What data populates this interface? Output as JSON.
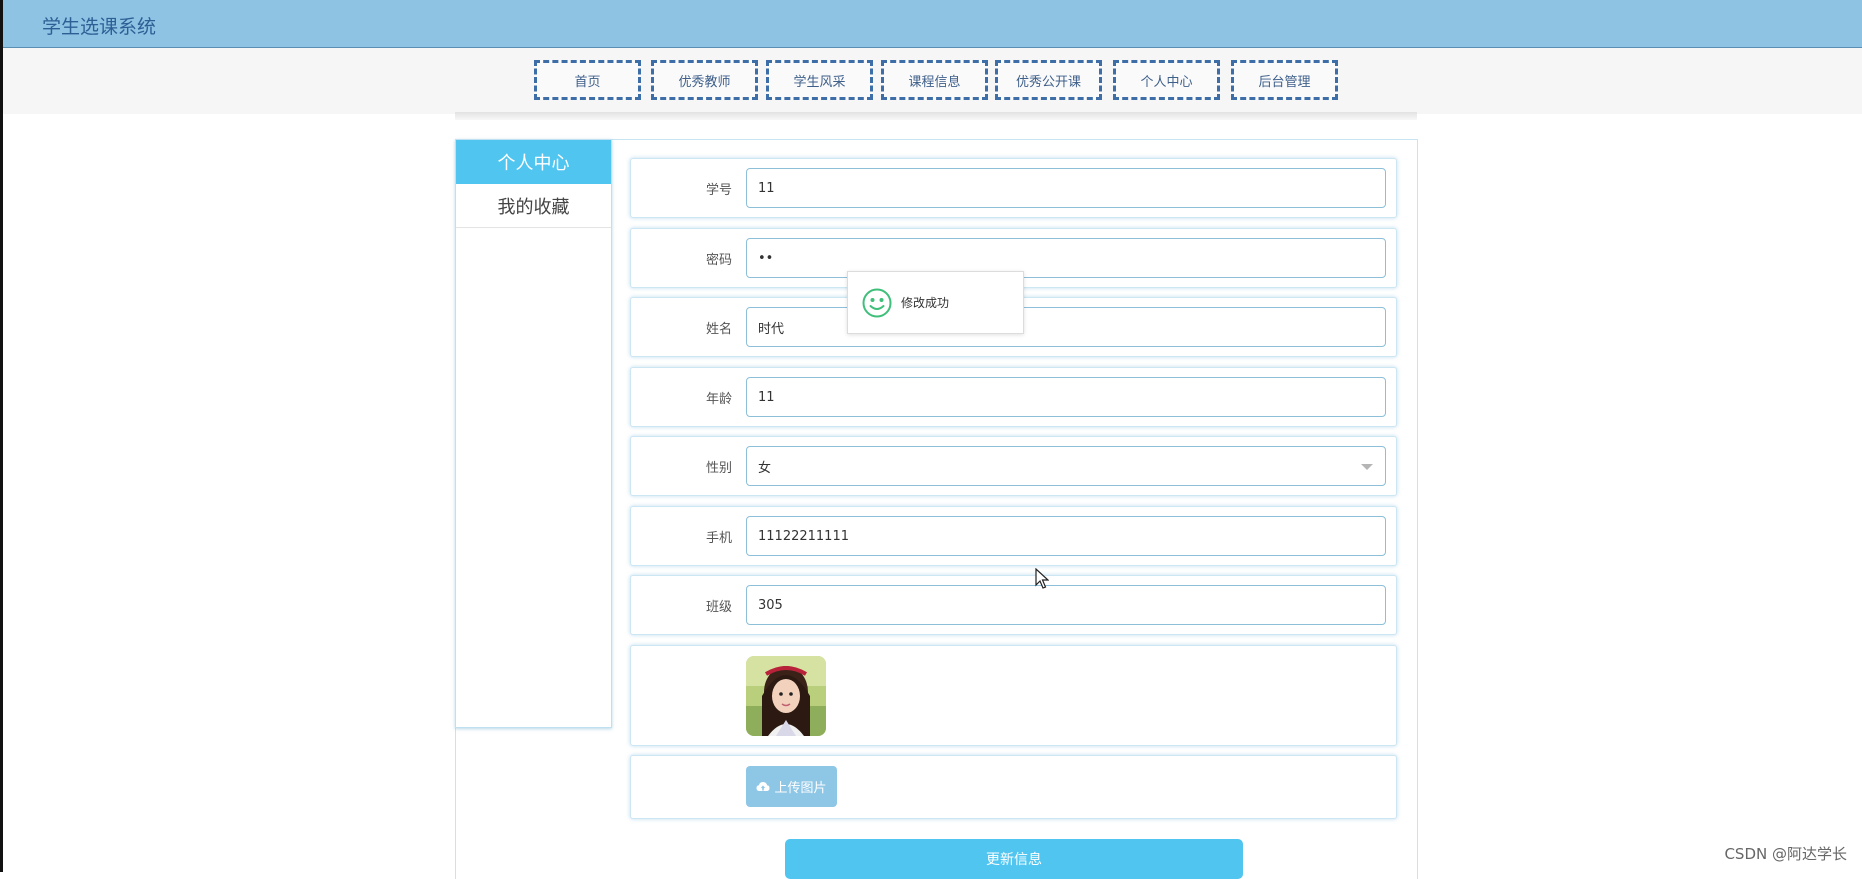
{
  "app": {
    "title": "学生选课系统"
  },
  "nav": {
    "items": [
      {
        "label": "首页"
      },
      {
        "label": "优秀教师"
      },
      {
        "label": "学生风采"
      },
      {
        "label": "课程信息"
      },
      {
        "label": "优秀公开课"
      },
      {
        "label": "个人中心"
      },
      {
        "label": "后台管理"
      }
    ]
  },
  "sidebar": {
    "items": [
      {
        "label": "个人中心",
        "active": true
      },
      {
        "label": "我的收藏",
        "active": false
      }
    ]
  },
  "form": {
    "student_id": {
      "label": "学号",
      "value": "11"
    },
    "password": {
      "label": "密码",
      "value": "••"
    },
    "name": {
      "label": "姓名",
      "value": "时代"
    },
    "age": {
      "label": "年龄",
      "value": "11"
    },
    "gender": {
      "label": "性别",
      "value": "女"
    },
    "phone": {
      "label": "手机",
      "value": "11122211111"
    },
    "class": {
      "label": "班级",
      "value": "305"
    },
    "upload_label": "上传图片",
    "submit_label": "更新信息"
  },
  "toast": {
    "message": "修改成功",
    "icon": "smile-icon"
  },
  "watermark": "CSDN @阿达学长",
  "colors": {
    "header": "#8ec3e4",
    "accent": "#4fc5f0",
    "nav_border": "#3e6ea7",
    "success": "#3fbf7a"
  }
}
